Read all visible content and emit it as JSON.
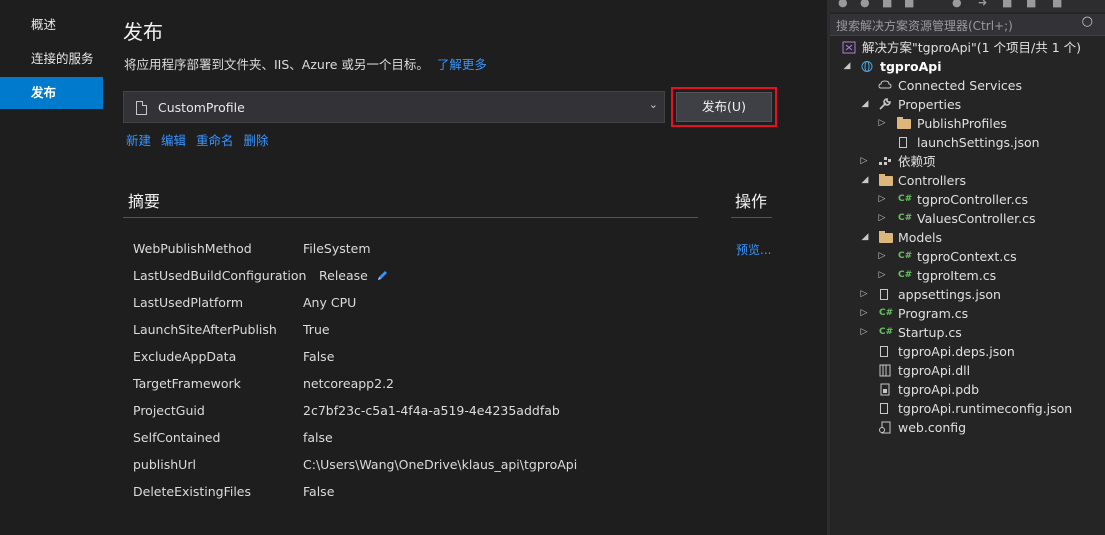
{
  "nav": {
    "items": [
      {
        "label": "概述"
      },
      {
        "label": "连接的服务"
      },
      {
        "label": "发布"
      }
    ]
  },
  "main": {
    "title": "发布",
    "description": "将应用程序部署到文件夹、IIS、Azure 或另一个目标。",
    "learn_more": "了解更多",
    "profile_select_value": "CustomProfile",
    "publish_button": "发布(U)",
    "profile_actions": [
      "新建",
      "编辑",
      "重命名",
      "删除"
    ],
    "summary_title": "摘要",
    "ops_title": "操作",
    "preview_link": "预览...",
    "properties": [
      {
        "key": "WebPublishMethod",
        "value": "FileSystem"
      },
      {
        "key": "LastUsedBuildConfiguration",
        "value": "Release"
      },
      {
        "key": "LastUsedPlatform",
        "value": "Any CPU"
      },
      {
        "key": "LaunchSiteAfterPublish",
        "value": "True"
      },
      {
        "key": "ExcludeAppData",
        "value": "False"
      },
      {
        "key": "TargetFramework",
        "value": "netcoreapp2.2"
      },
      {
        "key": "ProjectGuid",
        "value": "2c7bf23c-c5a1-4f4a-a519-4e4235addfab"
      },
      {
        "key": "SelfContained",
        "value": "false"
      },
      {
        "key": "publishUrl",
        "value": "C:\\Users\\Wang\\OneDrive\\klaus_api\\tgproApi"
      },
      {
        "key": "DeleteExistingFiles",
        "value": "False"
      }
    ]
  },
  "solution_explorer": {
    "search_placeholder": "搜索解决方案资源管理器(Ctrl+;)",
    "tree": [
      {
        "label": "解决方案\"tgproApi\"(1 个项目/共 1 个)",
        "icon": "solution-icon"
      },
      {
        "label": "tgproApi",
        "icon": "project-icon"
      },
      {
        "label": "Connected Services",
        "icon": "connected-services-icon"
      },
      {
        "label": "Properties",
        "icon": "wrench-icon"
      },
      {
        "label": "PublishProfiles",
        "icon": "folder-icon"
      },
      {
        "label": "launchSettings.json",
        "icon": "json-file-icon"
      },
      {
        "label": "依赖项",
        "icon": "dependencies-icon"
      },
      {
        "label": "Controllers",
        "icon": "folder-icon"
      },
      {
        "label": "tgproController.cs",
        "icon": "csharp-file-icon"
      },
      {
        "label": "ValuesController.cs",
        "icon": "csharp-file-icon"
      },
      {
        "label": "Models",
        "icon": "folder-icon"
      },
      {
        "label": "tgproContext.cs",
        "icon": "csharp-file-icon"
      },
      {
        "label": "tgproItem.cs",
        "icon": "csharp-file-icon"
      },
      {
        "label": "appsettings.json",
        "icon": "json-file-icon"
      },
      {
        "label": "Program.cs",
        "icon": "csharp-file-icon"
      },
      {
        "label": "Startup.cs",
        "icon": "csharp-file-icon"
      },
      {
        "label": "tgproApi.deps.json",
        "icon": "json-file-icon"
      },
      {
        "label": "tgproApi.dll",
        "icon": "dll-file-icon"
      },
      {
        "label": "tgproApi.pdb",
        "icon": "pdb-file-icon"
      },
      {
        "label": "tgproApi.runtimeconfig.json",
        "icon": "json-file-icon"
      },
      {
        "label": "web.config",
        "icon": "config-file-icon"
      }
    ]
  },
  "colors": {
    "accent": "#007acc",
    "link": "#3794ff",
    "highlight": "#e81123",
    "background": "#1e1e1e"
  }
}
